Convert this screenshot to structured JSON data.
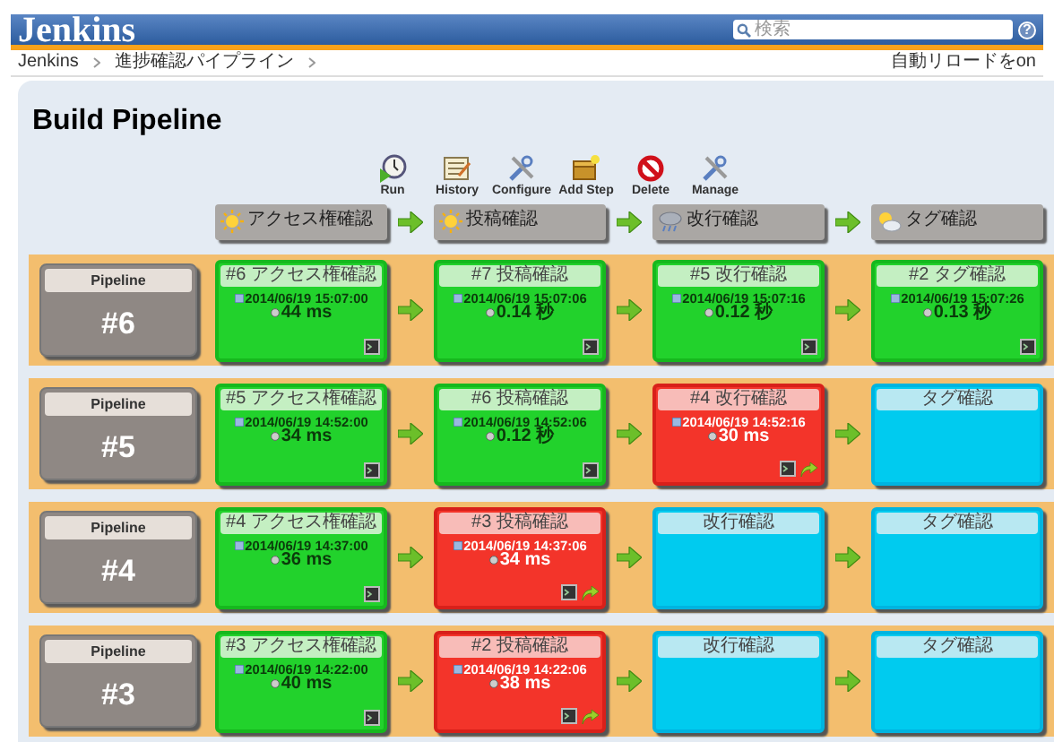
{
  "header": {
    "logo": "Jenkins",
    "search": {
      "placeholder": "検索"
    },
    "help": "?"
  },
  "breadcrumb": {
    "items": [
      "Jenkins",
      "進捗確認パイプライン"
    ],
    "auto_reload": "自動リロードをon"
  },
  "title": "Build Pipeline",
  "toolbar": [
    {
      "kind": "run",
      "label": "Run"
    },
    {
      "kind": "history",
      "label": "History"
    },
    {
      "kind": "configure",
      "label": "Configure"
    },
    {
      "kind": "add",
      "label": "Add Step"
    },
    {
      "kind": "delete",
      "label": "Delete"
    },
    {
      "kind": "manage",
      "label": "Manage"
    }
  ],
  "stages": [
    {
      "name": "アクセス権確認",
      "kind": "sunny"
    },
    {
      "name": "投稿確認",
      "kind": "sunny"
    },
    {
      "name": "改行確認",
      "kind": "stormy"
    },
    {
      "name": "タグ確認",
      "kind": "partly_cloudy"
    }
  ],
  "pipelines": [
    {
      "label": "Pipeline",
      "number": "#6",
      "builds": [
        {
          "kind": "success",
          "title": "#6 アクセス権確認",
          "date": "2014/06/19 15:07:00",
          "duration": "44 ms"
        },
        {
          "kind": "success",
          "title": "#7 投稿確認",
          "date": "2014/06/19 15:07:06",
          "duration": "0.14 秒"
        },
        {
          "kind": "success",
          "title": "#5 改行確認",
          "date": "2014/06/19 15:07:16",
          "duration": "0.12 秒"
        },
        {
          "kind": "success",
          "title": "#2 タグ確認",
          "date": "2014/06/19 15:07:26",
          "duration": "0.13 秒"
        }
      ]
    },
    {
      "label": "Pipeline",
      "number": "#5",
      "builds": [
        {
          "kind": "success",
          "title": "#5 アクセス権確認",
          "date": "2014/06/19 14:52:00",
          "duration": "34 ms"
        },
        {
          "kind": "success",
          "title": "#6 投稿確認",
          "date": "2014/06/19 14:52:06",
          "duration": "0.12 秒"
        },
        {
          "kind": "failed",
          "title": "#4 改行確認",
          "date": "2014/06/19 14:52:16",
          "duration": "30 ms"
        },
        {
          "kind": "pending",
          "title": "タグ確認"
        }
      ]
    },
    {
      "label": "Pipeline",
      "number": "#4",
      "builds": [
        {
          "kind": "success",
          "title": "#4 アクセス権確認",
          "date": "2014/06/19 14:37:00",
          "duration": "36 ms"
        },
        {
          "kind": "failed",
          "title": "#3 投稿確認",
          "date": "2014/06/19 14:37:06",
          "duration": "34 ms"
        },
        {
          "kind": "pending",
          "title": "改行確認"
        },
        {
          "kind": "pending",
          "title": "タグ確認"
        }
      ]
    },
    {
      "label": "Pipeline",
      "number": "#3",
      "builds": [
        {
          "kind": "success",
          "title": "#3 アクセス権確認",
          "date": "2014/06/19 14:22:00",
          "duration": "40 ms"
        },
        {
          "kind": "failed",
          "title": "#2 投稿確認",
          "date": "2014/06/19 14:22:06",
          "duration": "38 ms"
        },
        {
          "kind": "pending",
          "title": "改行確認"
        },
        {
          "kind": "pending",
          "title": "タグ確認"
        }
      ]
    }
  ]
}
